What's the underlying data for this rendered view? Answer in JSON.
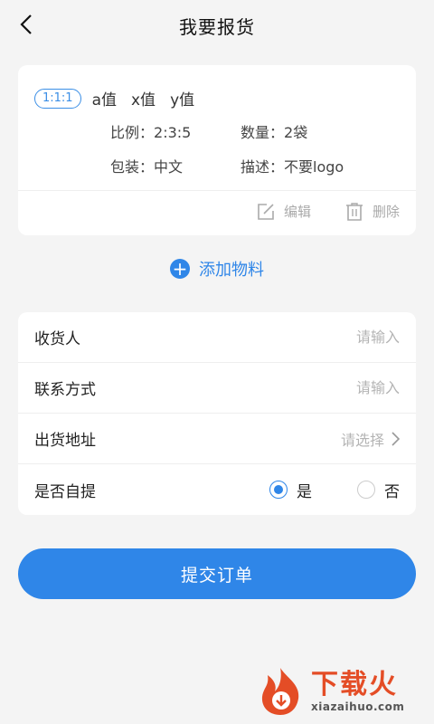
{
  "header": {
    "title": "我要报货"
  },
  "item": {
    "ratio": "1:1:1",
    "values": [
      "a值",
      "x值",
      "y值"
    ],
    "details": [
      {
        "key": "比例：",
        "value": "2:3:5"
      },
      {
        "key": "数量：",
        "value": "2袋"
      },
      {
        "key": "包装：",
        "value": "中文"
      },
      {
        "key": "描述：",
        "value": "不要logo"
      }
    ],
    "edit_label": "编辑",
    "delete_label": "删除"
  },
  "add_material": {
    "label": "添加物料"
  },
  "form": {
    "consignee": {
      "label": "收货人",
      "placeholder": "请输入",
      "value": ""
    },
    "contact": {
      "label": "联系方式",
      "placeholder": "请输入",
      "value": ""
    },
    "address": {
      "label": "出货地址",
      "placeholder": "请选择"
    },
    "self_pickup": {
      "label": "是否自提",
      "yes": "是",
      "no": "否",
      "selected": "yes"
    }
  },
  "submit": {
    "label": "提交订单"
  },
  "watermark": {
    "cn": "下载火",
    "en": "xiazaihuo.com"
  },
  "colors": {
    "accent": "#2f86e8",
    "watermark": "#e44d26"
  }
}
